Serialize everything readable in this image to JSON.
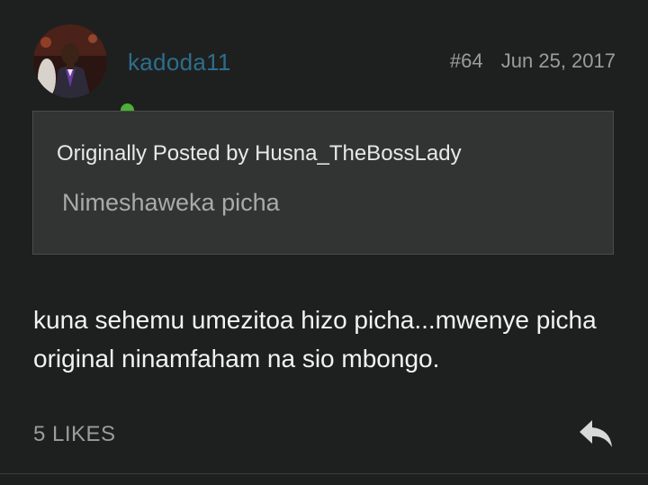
{
  "post": {
    "username": "kadoda11",
    "number": "#64",
    "date": "Jun 25, 2017",
    "online": true,
    "quote": {
      "author_line": "Originally Posted by Husna_TheBossLady",
      "text": "Nimeshaweka picha"
    },
    "body": "kuna sehemu umezitoa hizo picha...mwenye picha original ninamfaham na sio mbongo.",
    "likes": "5 LIKES",
    "icons": {
      "avatar": "user-avatar",
      "status": "online-status-dot",
      "reply": "reply-arrow-icon"
    },
    "colors": {
      "username": "#2e6d8d",
      "online": "#4caf38",
      "background": "#1e201f"
    }
  }
}
